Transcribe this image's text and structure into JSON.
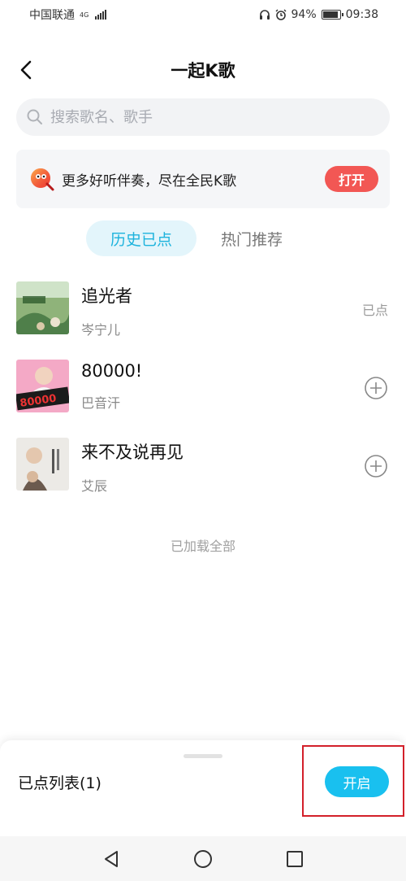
{
  "status_bar": {
    "carrier": "中国联通",
    "network": "4G",
    "battery": "94%",
    "battery_level": 0.94,
    "time": "09:38"
  },
  "header": {
    "title": "一起K歌",
    "back_icon": "chevron-left-icon"
  },
  "search": {
    "placeholder": "搜索歌名、歌手",
    "value": ""
  },
  "promo": {
    "text": "更多好听伴奏，尽在全民K歌",
    "button": "打开",
    "button_color": "#f25754"
  },
  "tabs": [
    {
      "label": "历史已点",
      "active": true
    },
    {
      "label": "热门推荐",
      "active": false
    }
  ],
  "songs": [
    {
      "title": "追光者",
      "artist": "岑宁儿",
      "status": "已点"
    },
    {
      "title": "80000!",
      "artist": "巴音汗",
      "status": ""
    },
    {
      "title": "来不及说再见",
      "artist": "艾辰",
      "status": ""
    }
  ],
  "list_footer": "已加载全部",
  "bottom_sheet": {
    "queue_label": "已点列表(1)",
    "enable_button": "开启",
    "accent": "#19c0ef"
  },
  "nav": {
    "back": "triangle-back-icon",
    "home": "circle-home-icon",
    "recents": "square-recents-icon"
  }
}
